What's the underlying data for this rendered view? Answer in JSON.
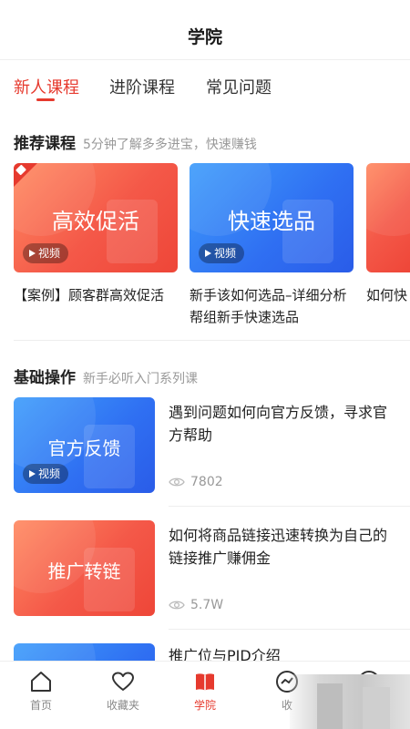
{
  "header": {
    "title": "学院"
  },
  "tabs": [
    {
      "label": "新人课程",
      "active": true
    },
    {
      "label": "进阶课程",
      "active": false
    },
    {
      "label": "常见问题",
      "active": false
    }
  ],
  "recommended": {
    "heading": "推荐课程",
    "subheading": "5分钟了解多多进宝，快速赚钱",
    "cards": [
      {
        "thumb_title": "高效促活",
        "badge": "视频",
        "caption": "【案例】顾客群高效促活",
        "theme": "red"
      },
      {
        "thumb_title": "快速选品",
        "badge": "视频",
        "caption": "新手该如何选品–详细分析帮组新手快速选品",
        "theme": "blue"
      },
      {
        "thumb_title": "",
        "badge": "",
        "caption": "如何快",
        "theme": "red"
      }
    ]
  },
  "basics": {
    "heading": "基础操作",
    "subheading": "新手必听入门系列课",
    "items": [
      {
        "thumb_title": "官方反馈",
        "badge": "视频",
        "title": "遇到问题如何向官方反馈，寻求官方帮助",
        "views": "7802",
        "theme": "blue"
      },
      {
        "thumb_title": "推广转链",
        "badge": "",
        "title": "如何将商品链接迅速转换为自己的链接推广赚佣金",
        "views": "5.7W",
        "theme": "red"
      },
      {
        "thumb_title": "",
        "badge": "",
        "title": "推广位与PID介绍",
        "views": "",
        "theme": "blue"
      }
    ]
  },
  "tabbar": [
    {
      "label": "首页",
      "icon": "home-icon",
      "active": false
    },
    {
      "label": "收藏夹",
      "icon": "heart-icon",
      "active": false
    },
    {
      "label": "学院",
      "icon": "book-icon",
      "active": true
    },
    {
      "label": "收",
      "icon": "trend-icon",
      "active": false
    },
    {
      "label": "",
      "icon": "smile-icon",
      "active": false
    }
  ],
  "colors": {
    "accent": "#e63a2e",
    "thumb_red": "#f45848",
    "thumb_blue": "#2f6ff2",
    "muted": "#999999"
  }
}
